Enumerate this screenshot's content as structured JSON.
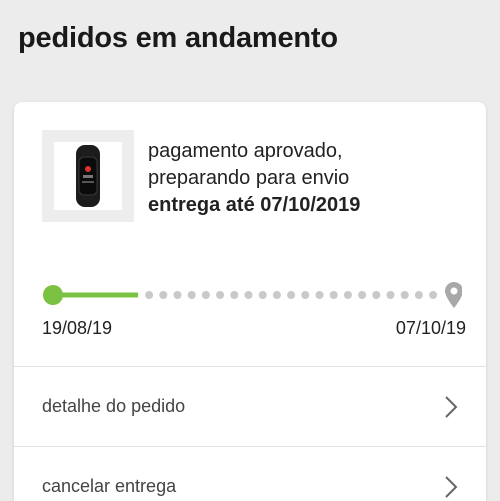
{
  "page": {
    "title": "pedidos em andamento"
  },
  "order": {
    "status_line1": "pagamento aprovado,",
    "status_line2": "preparando para envio",
    "delivery": "entrega até 07/10/2019",
    "product_icon": "fitness-band-icon"
  },
  "progress": {
    "start_date": "19/08/19",
    "end_date": "07/10/19",
    "fraction_complete": 0.22,
    "accent_color": "#7cc242",
    "pending_color": "#c9c9c9",
    "destination_icon": "location-pin-icon"
  },
  "actions": [
    {
      "label": "detalhe do pedido",
      "icon": "chevron-right-icon"
    },
    {
      "label": "cancelar entrega",
      "icon": "chevron-right-icon"
    }
  ]
}
